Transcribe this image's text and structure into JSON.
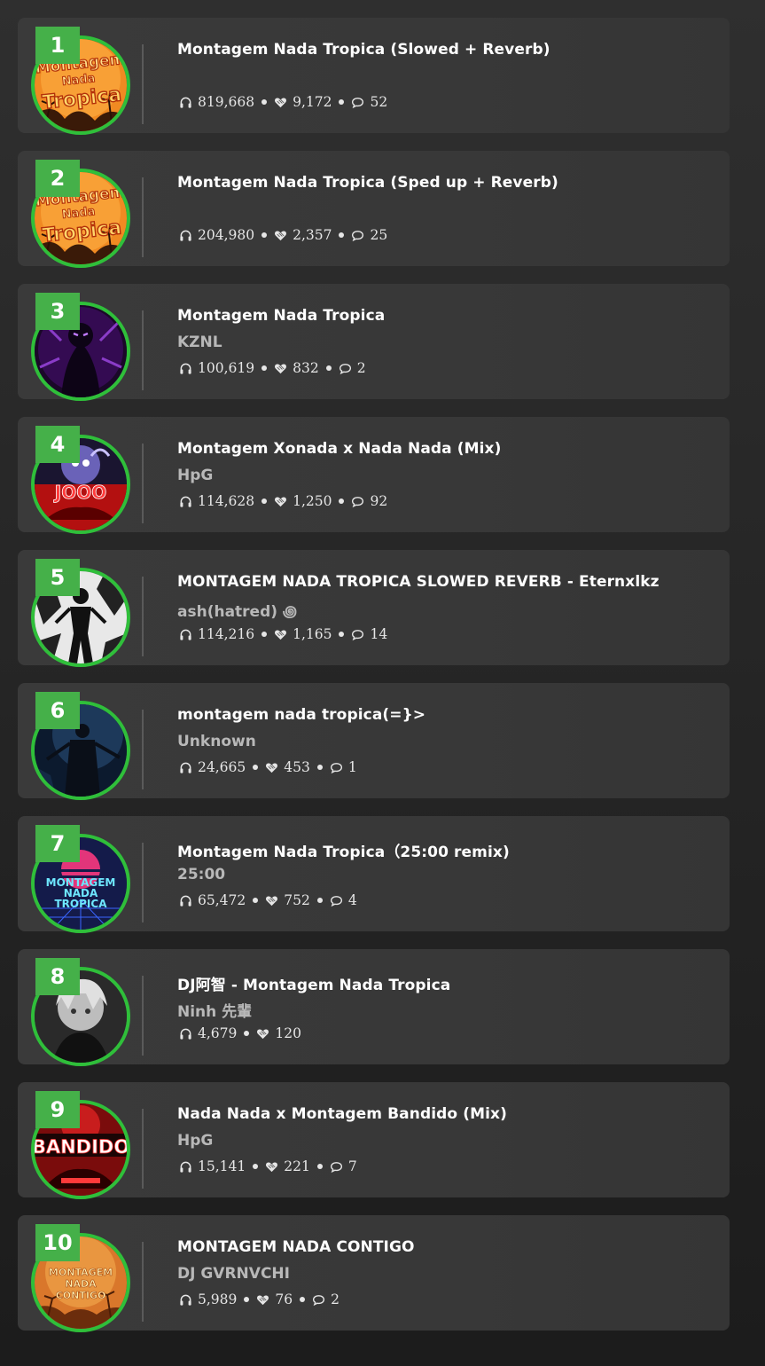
{
  "tracks": [
    {
      "rank": "1",
      "title": "Montagem Nada Tropica (Slowed + Reverb)",
      "artist": "",
      "plays": "819,668",
      "likes": "9,172",
      "comments": "52",
      "cover": "tropica-orange"
    },
    {
      "rank": "2",
      "title": "Montagem Nada Tropica (Sped up + Reverb)",
      "artist": "",
      "plays": "204,980",
      "likes": "2,357",
      "comments": "25",
      "cover": "tropica-orange"
    },
    {
      "rank": "3",
      "title": "Montagem Nada Tropica",
      "artist": "KZNL",
      "plays": "100,619",
      "likes": "832",
      "comments": "2",
      "cover": "purple-figure"
    },
    {
      "rank": "4",
      "title": "Montagem Xonada x Nada Nada (Mix)",
      "artist": "HpG",
      "plays": "114,628",
      "likes": "1,250",
      "comments": "92",
      "cover": "red-car"
    },
    {
      "rank": "5",
      "title": "MONTAGEM NADA TROPICA SLOWED REVERB - Eternxlkz",
      "artist": "ash(hatred) ꩜",
      "plays": "114,216",
      "likes": "1,165",
      "comments": "14",
      "cover": "bw-figure"
    },
    {
      "rank": "6",
      "title": "montagem nada tropica(=}>",
      "artist": "Unknown",
      "plays": "24,665",
      "likes": "453",
      "comments": "1",
      "cover": "blue-figure"
    },
    {
      "rank": "7",
      "title": "Montagem Nada Tropica（25:00 remix)",
      "artist": "25:00",
      "plays": "65,472",
      "likes": "752",
      "comments": "4",
      "cover": "synthwave"
    },
    {
      "rank": "8",
      "title": "DJ阿智 - Montagem Nada Tropica",
      "artist": "Ninh 先輩",
      "plays": "4,679",
      "likes": "120",
      "comments": "",
      "cover": "anime-gray"
    },
    {
      "rank": "9",
      "title": "Nada Nada x Montagem Bandido (Mix)",
      "artist": "HpG",
      "plays": "15,141",
      "likes": "221",
      "comments": "7",
      "cover": "bandido"
    },
    {
      "rank": "10",
      "title": "MONTAGEM NADA CONTIGO",
      "artist": "DJ GVRNVCHI",
      "plays": "5,989",
      "likes": "76",
      "comments": "2",
      "cover": "contigo"
    }
  ],
  "cover_texts": {
    "tropica_line1": "Montagem",
    "tropica_line2": "Nada",
    "tropica_line3": "Tropica",
    "synth_line1": "MONTAGEM",
    "synth_line2": "NADA",
    "synth_line3": "TROPICA",
    "bandido": "BANDIDO",
    "contigo_line1": "MONTAGEM",
    "contigo_line2": "NADA",
    "contigo_line3": "CONTIGO"
  },
  "colors": {
    "rank_badge": "#45b049",
    "cover_ring": "#2fbf3a",
    "card_bg": "#383838",
    "artist_text": "#b8b8b8"
  }
}
